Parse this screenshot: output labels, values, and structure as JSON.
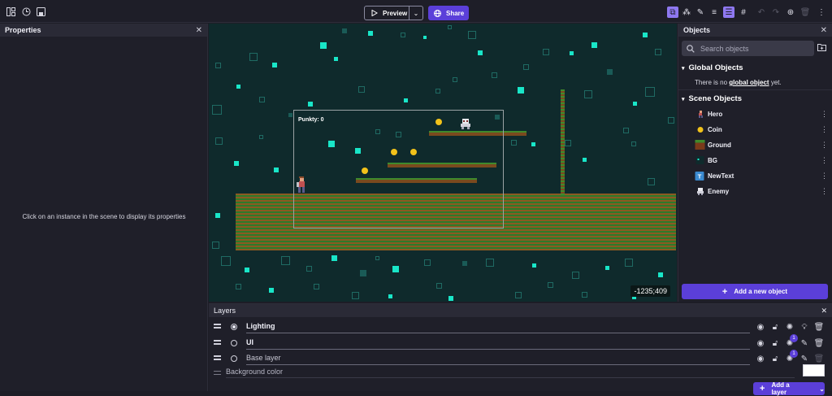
{
  "toolbar": {
    "preview_label": "Preview",
    "share_label": "Share"
  },
  "properties": {
    "title": "Properties",
    "empty_message": "Click on an instance in the scene to display its properties"
  },
  "scene": {
    "score_text": "Punkty: 0",
    "cursor_coords": "-1235;409"
  },
  "objects": {
    "title": "Objects",
    "search_placeholder": "Search objects",
    "global_title": "Global Objects",
    "global_empty_prefix": "There is no ",
    "global_empty_link": "global object",
    "global_empty_suffix": " yet.",
    "scene_title": "Scene Objects",
    "items": [
      {
        "name": "Hero",
        "icon": "hero-sprite"
      },
      {
        "name": "Coin",
        "icon": "coin-sprite"
      },
      {
        "name": "Ground",
        "icon": "ground-tile"
      },
      {
        "name": "BG",
        "icon": "bg-tile"
      },
      {
        "name": "NewText",
        "icon": "text-object"
      },
      {
        "name": "Enemy",
        "icon": "enemy-sprite"
      }
    ],
    "add_label": "Add a new object"
  },
  "layers": {
    "title": "Layers",
    "items": [
      {
        "name": "Lighting",
        "badge": ""
      },
      {
        "name": "UI",
        "badge": "1"
      },
      {
        "name": "Base layer",
        "badge": "1"
      }
    ],
    "background_label": "Background color",
    "background_color": "#ffffff",
    "add_label": "Add a layer"
  },
  "colors": {
    "accent": "#5b3fd9",
    "scene_bg": "#0f2a2c",
    "tile_bright": "#19e6c8",
    "coin": "#f2c21a"
  }
}
